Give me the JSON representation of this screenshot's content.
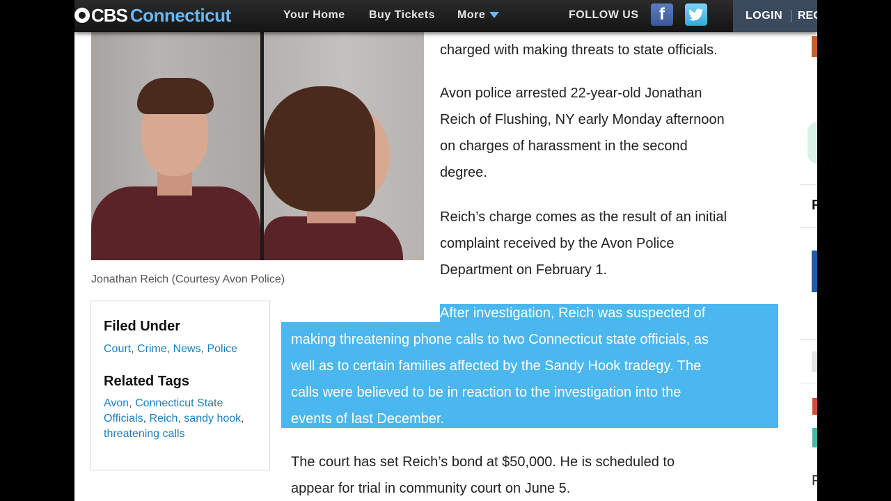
{
  "nav": {
    "logo_cbs": "CBS",
    "logo_region": "Connecticut",
    "links": [
      "Your Home",
      "Buy Tickets",
      "More"
    ],
    "follow_label": "FOLLOW US",
    "login_label": "LOGIN",
    "register_label": "REG"
  },
  "photo": {
    "caption": "Jonathan Reich (Courtesy Avon Police)"
  },
  "filed": {
    "heading": "Filed Under",
    "links": [
      "Court",
      "Crime",
      "News",
      "Police"
    ]
  },
  "tags": {
    "heading": "Related Tags",
    "links": [
      "Avon",
      "Connecticut State Officials",
      "Reich",
      "sandy hook",
      "threatening calls"
    ]
  },
  "article": {
    "p0": "charged with making threats to state officials.",
    "p1": [
      "Avon police arrested 22-year-old Jonathan",
      "Reich of Flushing, NY early Monday afternoon",
      "on charges of harassment in the second",
      "degree."
    ],
    "p2": [
      "Reich’s charge comes as the result of an initial",
      "complaint received by the Avon Police",
      "Department on February 1."
    ],
    "p3": [
      "After investigation, Reich was suspected of",
      "making threatening phone calls to two Connecticut state officials, as",
      "well as to certain families affected by the Sandy Hook tradegy. The",
      "calls were believed to be in reaction to the investigation into the",
      "events of last December."
    ],
    "p4": [
      "The court has set Reich’s bond at $50,000.  He is scheduled to",
      "appear for trial in community court on June 5."
    ]
  },
  "sidebar_fragments": [
    "F",
    "F"
  ],
  "colors": {
    "nav_bg": "#1f1f1f",
    "brand_blue": "#6ab7f2",
    "link_blue": "#1a7fc1",
    "selection": "#4ab7ee",
    "login_bg": "#3a4a5c"
  }
}
